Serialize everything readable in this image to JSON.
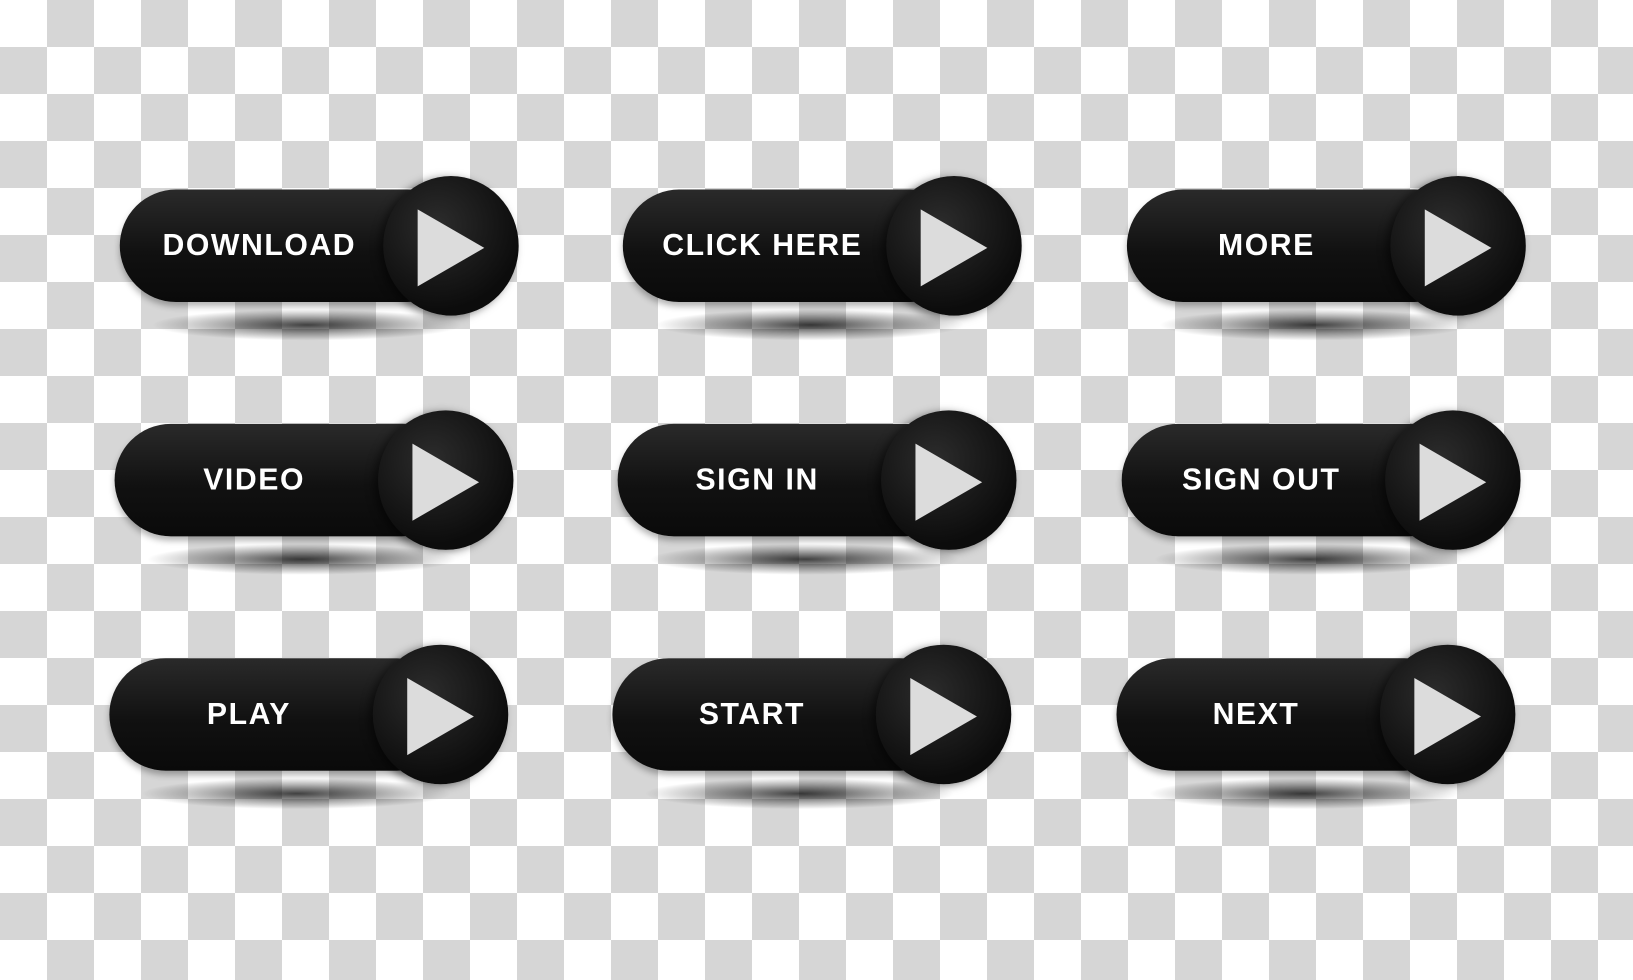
{
  "buttons": [
    {
      "label": "DOWNLOAD",
      "icon": "play-arrow-icon"
    },
    {
      "label": "CLICK HERE",
      "icon": "play-arrow-icon"
    },
    {
      "label": "MORE",
      "icon": "play-arrow-icon"
    },
    {
      "label": "VIDEO",
      "icon": "play-arrow-icon"
    },
    {
      "label": "SIGN IN",
      "icon": "play-arrow-icon"
    },
    {
      "label": "SIGN OUT",
      "icon": "play-arrow-icon"
    },
    {
      "label": "PLAY",
      "icon": "play-arrow-icon"
    },
    {
      "label": "START",
      "icon": "play-arrow-icon"
    },
    {
      "label": "NEXT",
      "icon": "play-arrow-icon"
    }
  ],
  "colors": {
    "button": "#111111",
    "arrow": "#dcdcdc",
    "text": "#ffffff",
    "checker": "#d6d6d6"
  }
}
